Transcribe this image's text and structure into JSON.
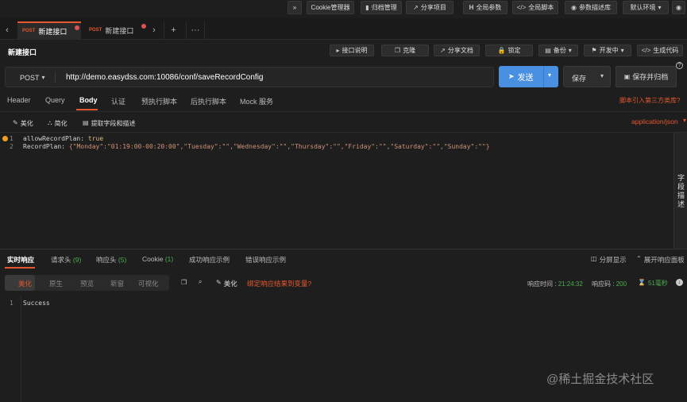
{
  "toolbar": {
    "buttons": [
      {
        "label": "»",
        "icon": "double-chevron-icon"
      },
      {
        "label": "Cookie管理器",
        "icon": ""
      },
      {
        "label": "归档管理",
        "icon": "archive-icon"
      },
      {
        "label": "分享项目",
        "icon": "share-icon"
      },
      {
        "label": "全局参数",
        "icon": "h-icon"
      },
      {
        "label": "全局脚本",
        "icon": "code-icon"
      },
      {
        "label": "参数描述库",
        "icon": "library-icon"
      },
      {
        "label": "默认环境",
        "icon": "chevron-down-icon"
      },
      {
        "label": "",
        "icon": "eye-icon"
      }
    ]
  },
  "tabs": [
    {
      "method": "POST",
      "label": "新建接口",
      "active": true
    },
    {
      "method": "POST",
      "label": "新建接口",
      "active": false
    }
  ],
  "tabbar": {
    "add": "+",
    "more": "···",
    "prev": "‹",
    "next": "›"
  },
  "request": {
    "title": "新建接口",
    "actions": [
      {
        "label": "接口说明",
        "icon": "play-icon"
      },
      {
        "label": "克隆",
        "icon": "clone-icon"
      },
      {
        "label": "分享文档",
        "icon": "share-icon"
      },
      {
        "label": "锁定",
        "icon": "lock-icon"
      },
      {
        "label": "备份",
        "icon": "backup-icon"
      },
      {
        "label": "开发中",
        "icon": "flag-icon"
      },
      {
        "label": "生成代码",
        "icon": "code-icon"
      }
    ],
    "method": "POST",
    "url": "http://demo.easydss.com:10086/conf/saveRecordConfig",
    "send_label": "发送",
    "save_label": "保存",
    "save_archive_label": "保存并归档",
    "help": "?"
  },
  "param_tabs": [
    "Header",
    "Query",
    "Body",
    "认证",
    "预执行脚本",
    "后执行脚本",
    "Mock 服务"
  ],
  "active_param_tab": "Body",
  "third_party_link": "脚本引入第三方类库?",
  "body_tools": {
    "beautify": "美化",
    "simplify": "简化",
    "extract": "提取字段和描述",
    "content_type": "application/json"
  },
  "body_lines": [
    {
      "num": "1",
      "key": "allowRecordPlan",
      "sep": ": ",
      "value": "true"
    },
    {
      "num": "2",
      "key": "RecordPlan",
      "sep": ": ",
      "value": "{\"Monday\":\"01:19:00-00:20:00\",\"Tuesday\":\"\",\"Wednesday\":\"\",\"Thursday\":\"\",\"Friday\":\"\",\"Saturday\":\"\",\"Sunday\":\"\"}"
    }
  ],
  "side_panel_label": "字段描述",
  "response": {
    "tabs": [
      {
        "label": "实时响应",
        "count": ""
      },
      {
        "label": "请求头",
        "count": "(9)"
      },
      {
        "label": "响应头",
        "count": "(5)"
      },
      {
        "label": "Cookie",
        "count": "(1)"
      },
      {
        "label": "成功响应示例",
        "count": ""
      },
      {
        "label": "错误响应示例",
        "count": ""
      }
    ],
    "split_label": "分屏显示",
    "expand_label": "展开响应面板",
    "view_tabs": [
      "美化",
      "原生",
      "预览",
      "新窗",
      "可视化"
    ],
    "beautify": "美化",
    "bind_link": "绑定响应结果到变量?",
    "time_label": "响应时间 :",
    "time_value": "21:24:32",
    "code_label": "响应码 :",
    "code_value": "200",
    "duration": "51毫秒",
    "lines": [
      {
        "num": "1",
        "text": "Success"
      }
    ]
  },
  "watermark": "@稀土掘金技术社区",
  "colors": {
    "accent": "#e4572e",
    "send": "#4a90e2",
    "success": "#4caf50"
  }
}
